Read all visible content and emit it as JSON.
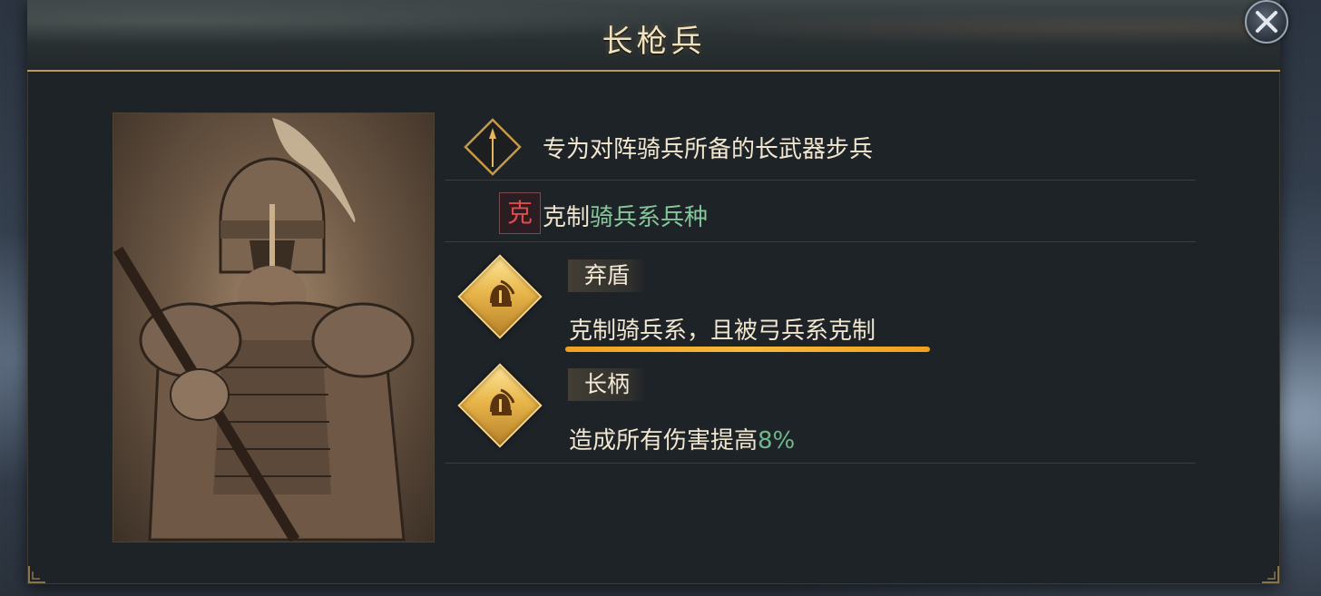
{
  "dialog": {
    "title": "长枪兵",
    "close_icon": "close-icon"
  },
  "unit": {
    "portrait_icon": "spearman-portrait",
    "description": "专为对阵骑兵所备的长武器步兵",
    "counter": {
      "badge": "克",
      "prefix": "克制",
      "target": "骑兵系兵种"
    },
    "traits": [
      {
        "name": "弃盾",
        "effect": "克制骑兵系，且被弓兵系克制",
        "icon": "helmet-icon"
      },
      {
        "name": "长柄",
        "effect_prefix": "造成所有伤害提高",
        "effect_value": "8%",
        "icon": "helmet-icon"
      }
    ]
  },
  "colors": {
    "accent_gold": "#b89a5c",
    "highlight_green": "#85c79a",
    "counter_red": "#e04b4b",
    "underline_orange": "#f0a020"
  }
}
